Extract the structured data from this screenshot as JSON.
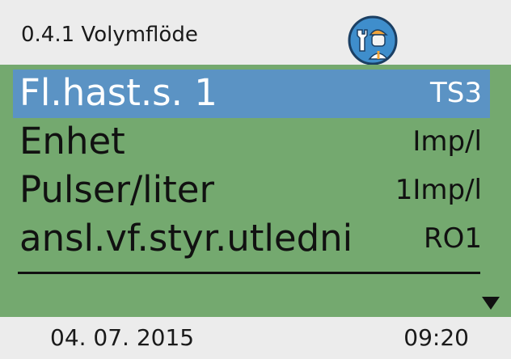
{
  "header": {
    "title": "0.4.1 Volymflöde",
    "role_icon": "technician-icon"
  },
  "menu": {
    "rows": [
      {
        "label": "Fl.hast.s. 1",
        "value": "TS3",
        "selected": true
      },
      {
        "label": "Enhet",
        "value": "Imp/l",
        "selected": false
      },
      {
        "label": "Pulser/liter",
        "value": "1Imp/l",
        "selected": false
      },
      {
        "label": "ansl.vf.styr.utledni",
        "value": "RO1",
        "selected": false
      }
    ],
    "scroll_indicator": "triangle-down-icon"
  },
  "footer": {
    "date": "04. 07. 2015",
    "time": "09:20"
  },
  "colors": {
    "background": "#ececec",
    "menu_background": "#74a96f",
    "selection": "#5b93c4"
  }
}
